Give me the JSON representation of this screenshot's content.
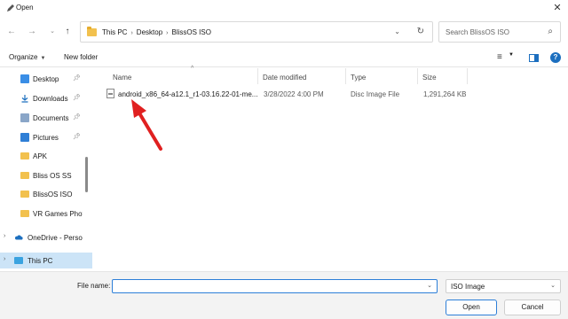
{
  "window": {
    "title": "Open"
  },
  "address": {
    "crumbs": [
      "This PC",
      "Desktop",
      "BlissOS ISO"
    ],
    "search_placeholder": "Search BlissOS ISO"
  },
  "commands": {
    "organize": "Organize",
    "new_folder": "New folder"
  },
  "sidebar": {
    "items": [
      {
        "label": "Desktop",
        "icon": "desktop-icon",
        "pinned": true
      },
      {
        "label": "Downloads",
        "icon": "download-icon",
        "pinned": true
      },
      {
        "label": "Documents",
        "icon": "documents-icon",
        "pinned": true
      },
      {
        "label": "Pictures",
        "icon": "pictures-icon",
        "pinned": true
      },
      {
        "label": "APK",
        "icon": "folder-icon",
        "pinned": false
      },
      {
        "label": "Bliss OS SS",
        "icon": "folder-icon",
        "pinned": false
      },
      {
        "label": "BlissOS ISO",
        "icon": "folder-icon",
        "pinned": false
      },
      {
        "label": "VR Games Phot",
        "icon": "folder-icon",
        "pinned": false
      },
      {
        "label": "OneDrive - Perso",
        "icon": "cloud-icon",
        "pinned": false
      },
      {
        "label": "This PC",
        "icon": "pc-icon",
        "pinned": false,
        "selected": true
      }
    ]
  },
  "columns": {
    "name": "Name",
    "date": "Date modified",
    "type": "Type",
    "size": "Size"
  },
  "files": [
    {
      "name": "android_x86_64-a12.1_r1-03.16.22-01-me...",
      "date": "3/28/2022 4:00 PM",
      "type": "Disc Image File",
      "size": "1,291,264 KB"
    }
  ],
  "footer": {
    "file_name_label": "File name:",
    "file_name_value": "",
    "file_type": "ISO Image",
    "open_label": "Open",
    "cancel_label": "Cancel"
  },
  "colors": {
    "accent": "#1c6fbf",
    "annotation_arrow": "#e02020",
    "selection": "#cce4f7"
  }
}
